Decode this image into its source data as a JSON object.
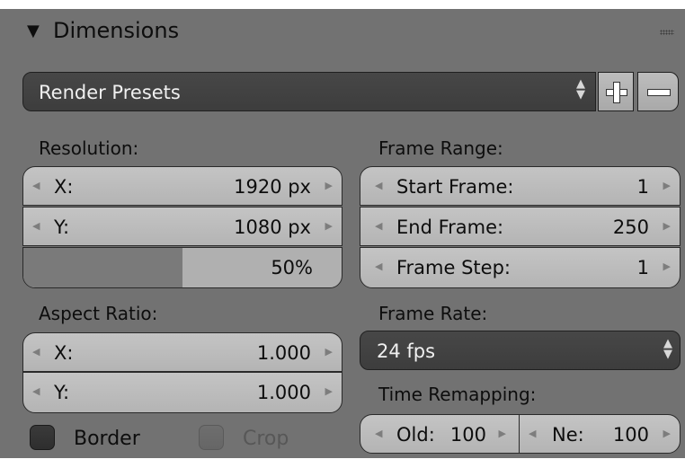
{
  "panel": {
    "title": "Dimensions",
    "collapse_icon": "triangle-down-icon",
    "grip_icon": "drag-grip-icon"
  },
  "presets": {
    "label": "Render Presets",
    "add_icon": "plus-icon",
    "remove_icon": "minus-icon"
  },
  "resolution": {
    "label": "Resolution:",
    "x_label": "X:",
    "x_value": "1920 px",
    "y_label": "Y:",
    "y_value": "1080 px",
    "percentage": "50%",
    "percentage_fraction": 0.5
  },
  "frame_range": {
    "label": "Frame Range:",
    "start_label": "Start Frame:",
    "start_value": "1",
    "end_label": "End Frame:",
    "end_value": "250",
    "step_label": "Frame Step:",
    "step_value": "1"
  },
  "aspect_ratio": {
    "label": "Aspect Ratio:",
    "x_label": "X:",
    "x_value": "1.000",
    "y_label": "Y:",
    "y_value": "1.000"
  },
  "frame_rate": {
    "label": "Frame Rate:",
    "value": "24 fps"
  },
  "time_remapping": {
    "label": "Time Remapping:",
    "old_label": "Old:",
    "old_value": "100",
    "new_label": "Ne:",
    "new_value": "100"
  },
  "border": {
    "label": "Border",
    "checked": false
  },
  "crop": {
    "label": "Crop",
    "checked": false,
    "enabled": false
  },
  "colors": {
    "panel_bg": "#727272",
    "field_bg": "#bdbdbd",
    "dark_widget": "#424242",
    "text": "#0d0d0d"
  }
}
